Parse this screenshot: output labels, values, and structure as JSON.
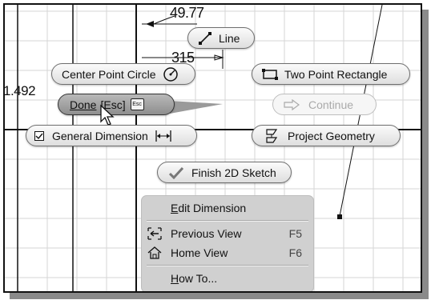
{
  "dimensions": {
    "top_value": "49.77",
    "mid_value": "315",
    "left_value": "1.492"
  },
  "marking_menu": {
    "line": "Line",
    "center_point_circle": "Center Point Circle",
    "two_point_rectangle": "Two Point Rectangle",
    "done_label": "Done",
    "done_shortcut": "[Esc]",
    "esc_key": "Esc",
    "continue": "Continue",
    "general_dimension": "General Dimension",
    "project_geometry": "Project Geometry",
    "finish_2d_sketch": "Finish 2D Sketch"
  },
  "context_menu": {
    "items": [
      {
        "label": "Edit Dimension",
        "mnemonic": "E",
        "rest": "dit Dimension",
        "shortcut": ""
      },
      {
        "label": "Previous View",
        "shortcut": "F5",
        "icon": "previous-view-icon"
      },
      {
        "label": "Home View",
        "shortcut": "F6",
        "icon": "home-view-icon"
      },
      {
        "label": "How To...",
        "mnemonic": "H",
        "rest": "ow To...",
        "shortcut": ""
      }
    ]
  },
  "colors": {
    "background": "#ffffff",
    "grid": "#d6d6d6",
    "menu_bg": "#d0d0d0",
    "pill_dark": "#9c9c9c"
  }
}
